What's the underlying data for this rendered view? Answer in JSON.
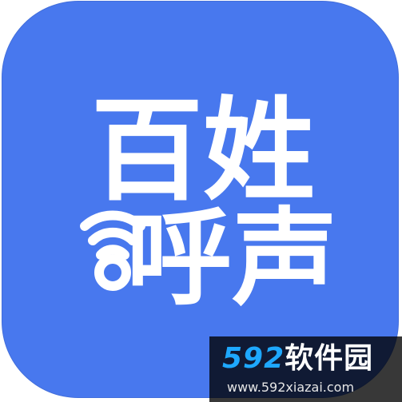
{
  "app_logo": {
    "line1": "百姓",
    "line2": "呼声",
    "background_color": "#4878ee",
    "text_color": "#ffffff",
    "signal_icon": "wifi-signal-icon"
  },
  "watermark": {
    "digits": "592",
    "name": "软件园",
    "url": "www.592xiazai.com",
    "digit_color": "#1ea8ff"
  }
}
